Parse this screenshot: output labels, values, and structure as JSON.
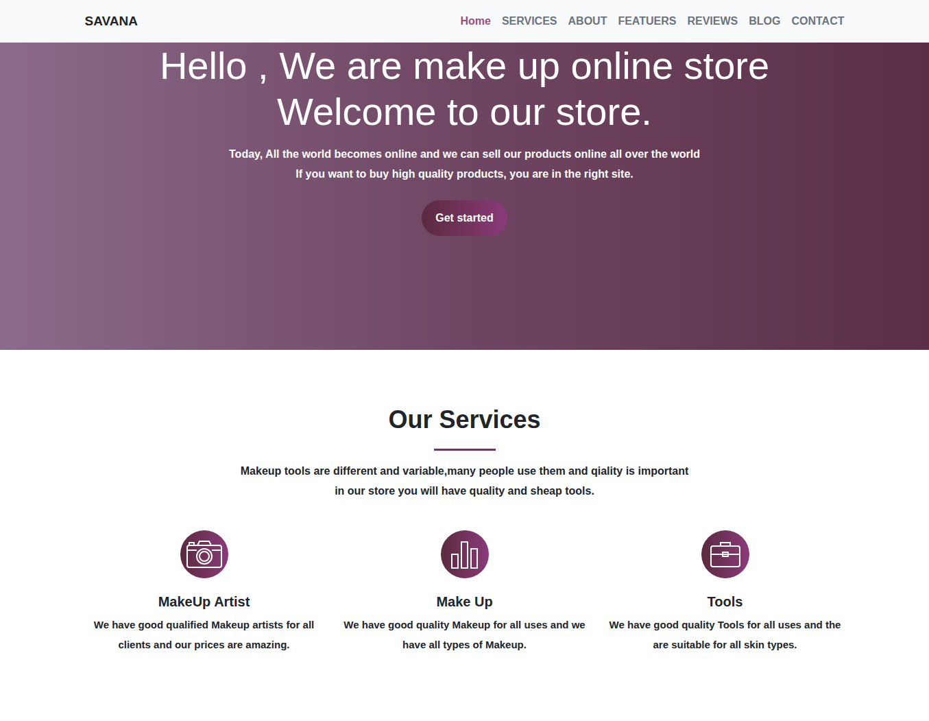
{
  "navbar": {
    "brand": "SAVANA",
    "links": [
      {
        "label": "Home",
        "selected": true
      },
      {
        "label": "SERVICES",
        "selected": false
      },
      {
        "label": "ABOUT",
        "selected": false
      },
      {
        "label": "FEATUERS",
        "selected": false
      },
      {
        "label": "REVIEWS",
        "selected": false
      },
      {
        "label": "BLOG",
        "selected": false
      },
      {
        "label": "CONTACT",
        "selected": false
      }
    ]
  },
  "hero": {
    "title_lines": [
      "Hello , We are make up online store",
      "Welcome to our store."
    ],
    "subtitle_lines": [
      "Today, All the world becomes online and we can sell our products online all over the world",
      "If you want to buy high quality products, you are in the right site."
    ],
    "button": "Get started"
  },
  "services": {
    "heading": "Our Services",
    "intro_lines": [
      "Makeup tools are different and variable,many people use them and qiality is important",
      "in our store you will have quality and sheap tools."
    ],
    "cards": [
      {
        "title": "MakeUp Artist",
        "lines": [
          "We have good qualified Makeup artists for all",
          "clients and our prices are amazing."
        ]
      },
      {
        "title": "Make Up",
        "lines": [
          "We have good quality Makeup for all uses and we",
          "have all types of Makeup."
        ]
      },
      {
        "title": "Tools",
        "lines": [
          "We have good quality Tools for all uses and the",
          "are suitable for all skin types."
        ]
      }
    ]
  }
}
